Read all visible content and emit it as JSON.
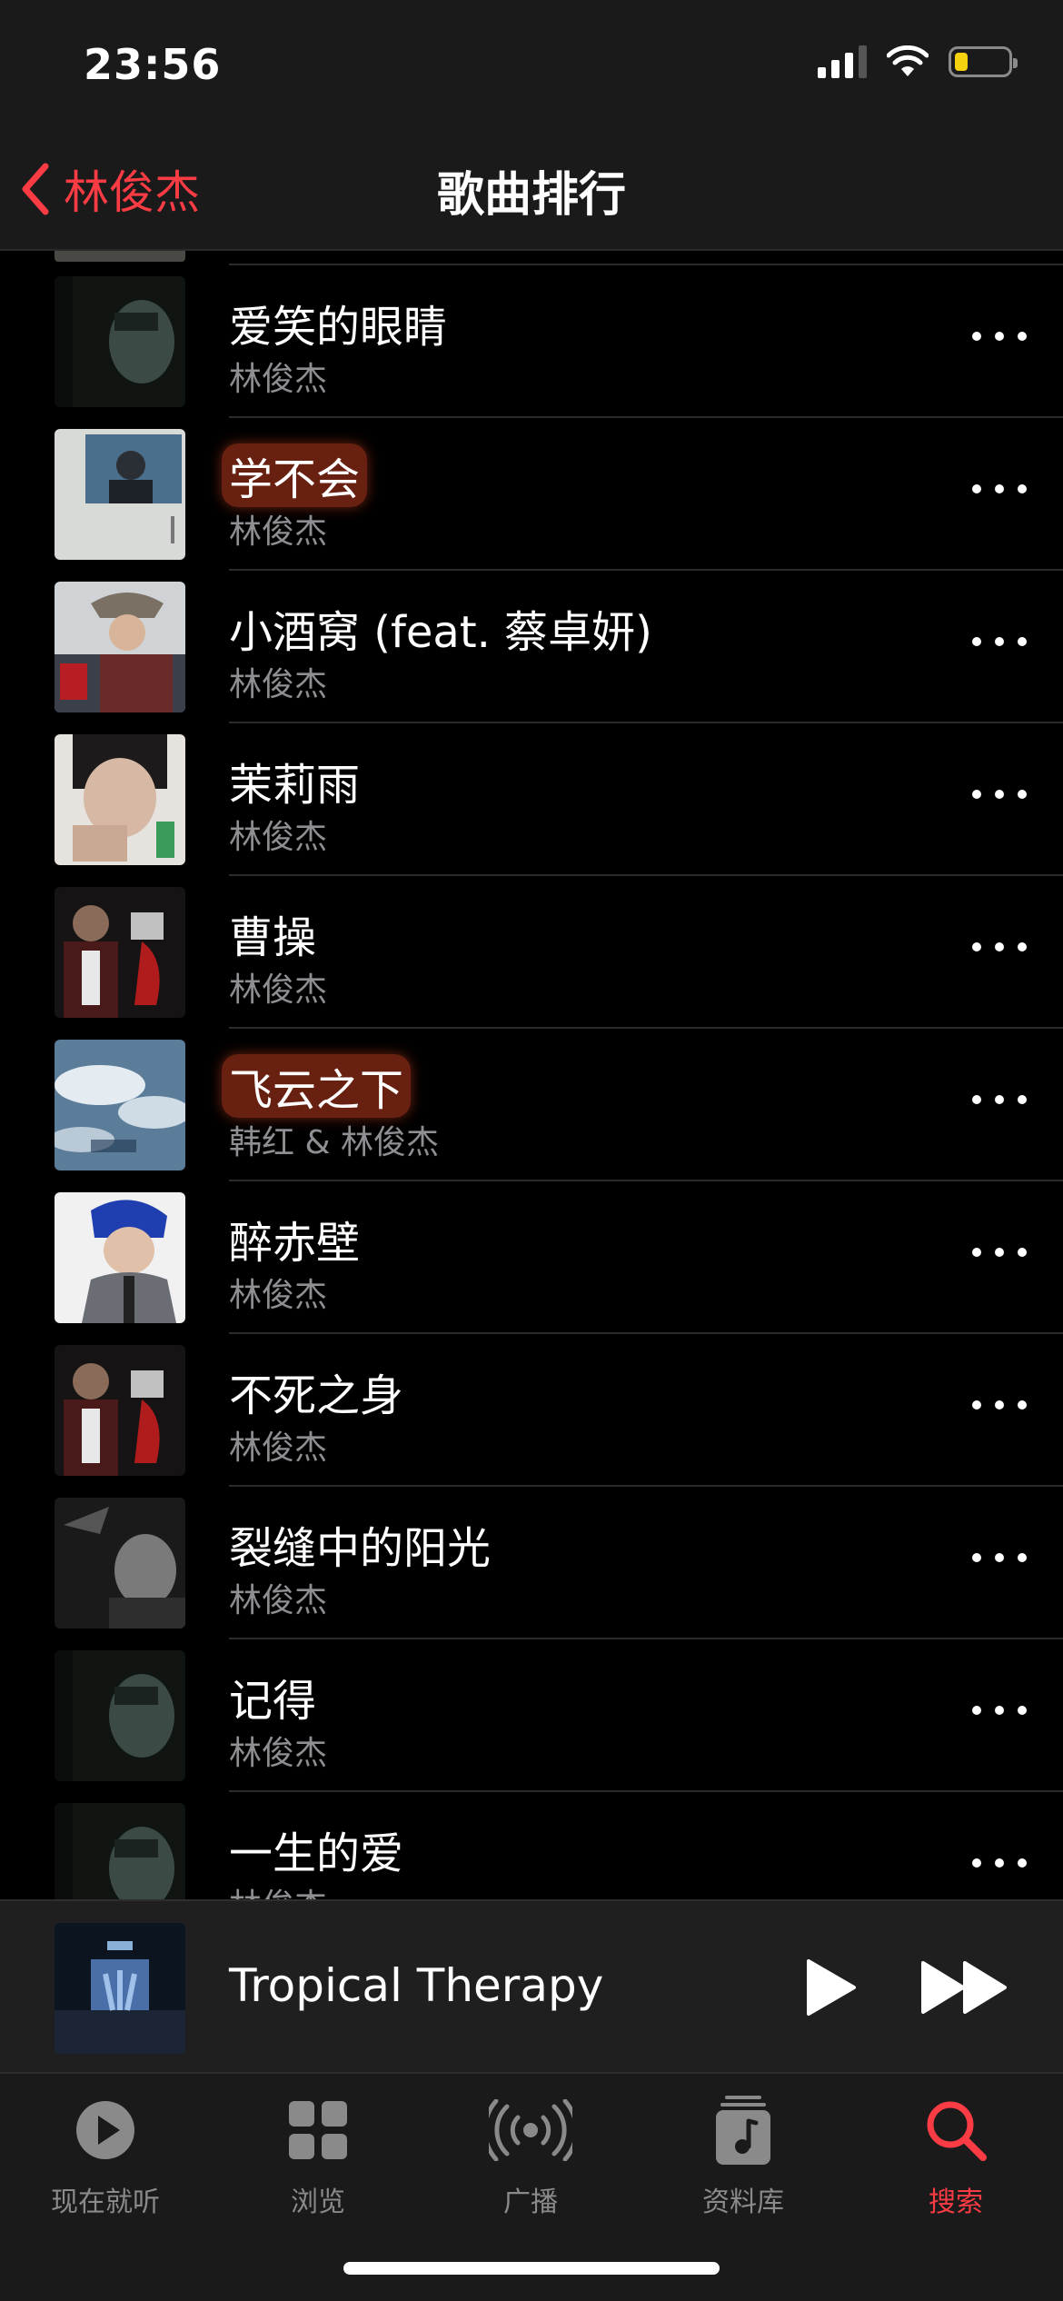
{
  "status": {
    "time": "23:56"
  },
  "nav": {
    "back_label": "林俊杰",
    "title": "歌曲排行"
  },
  "songs": [
    {
      "title": "爱笑的眼睛",
      "artist": "林俊杰",
      "highlight": false
    },
    {
      "title": "学不会",
      "artist": "林俊杰",
      "highlight": true
    },
    {
      "title": "小酒窝 (feat. 蔡卓妍)",
      "artist": "林俊杰",
      "highlight": false
    },
    {
      "title": "茉莉雨",
      "artist": "林俊杰",
      "highlight": false
    },
    {
      "title": "曹操",
      "artist": "林俊杰",
      "highlight": false
    },
    {
      "title": "飞云之下",
      "artist": "韩红 & 林俊杰",
      "highlight": true
    },
    {
      "title": "醉赤壁",
      "artist": "林俊杰",
      "highlight": false
    },
    {
      "title": "不死之身",
      "artist": "林俊杰",
      "highlight": false
    },
    {
      "title": "裂缝中的阳光",
      "artist": "林俊杰",
      "highlight": false
    },
    {
      "title": "记得",
      "artist": "林俊杰",
      "highlight": false
    },
    {
      "title": "一生的爱",
      "artist": "林俊杰",
      "highlight": false
    }
  ],
  "mini_player": {
    "title": "Tropical Therapy"
  },
  "tabs": [
    {
      "label": "现在就听",
      "icon": "play-circle-icon",
      "active": false
    },
    {
      "label": "浏览",
      "icon": "grid-icon",
      "active": false
    },
    {
      "label": "广播",
      "icon": "broadcast-icon",
      "active": false
    },
    {
      "label": "资料库",
      "icon": "music-library-icon",
      "active": false
    },
    {
      "label": "搜索",
      "icon": "search-icon",
      "active": true
    }
  ],
  "colors": {
    "accent": "#fc3c44",
    "secondary_text": "#8e8e93"
  }
}
